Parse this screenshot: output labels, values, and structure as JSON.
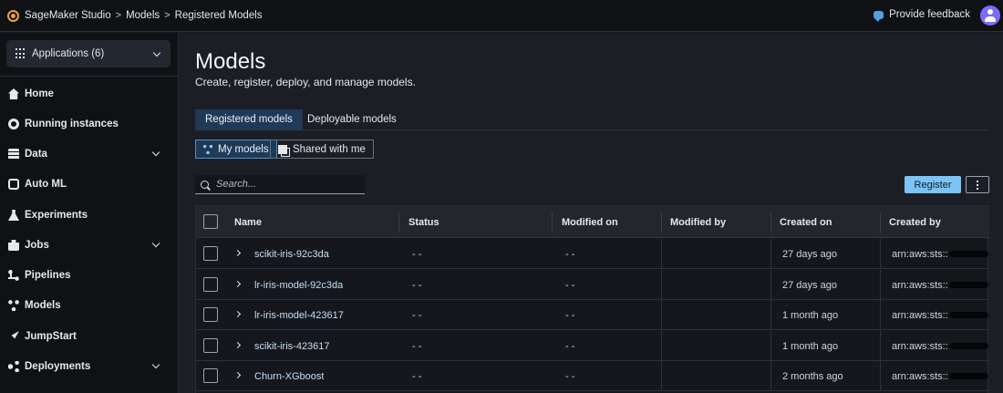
{
  "topbar": {
    "breadcrumbs": [
      "SageMaker Studio",
      "Models",
      "Registered Models"
    ],
    "breadcrumb_separator": ">",
    "feedback_label": "Provide feedback"
  },
  "sidebar": {
    "applications_label": "Applications (6)",
    "items": [
      {
        "label": "Home",
        "icon": "home-icon"
      },
      {
        "label": "Running instances",
        "icon": "gear-icon"
      },
      {
        "label": "Data",
        "icon": "database-icon"
      },
      {
        "label": "Auto ML",
        "icon": "automl-icon"
      },
      {
        "label": "Experiments",
        "icon": "flask-icon"
      },
      {
        "label": "Jobs",
        "icon": "briefcase-icon"
      },
      {
        "label": "Pipelines",
        "icon": "pipeline-icon"
      },
      {
        "label": "Models",
        "icon": "models-icon"
      },
      {
        "label": "JumpStart",
        "icon": "rocket-icon"
      },
      {
        "label": "Deployments",
        "icon": "share-icon"
      }
    ]
  },
  "main": {
    "title": "Models",
    "subtitle": "Create, register, deploy, and manage models.",
    "tabs": [
      "Registered models",
      "Deployable models"
    ],
    "filters": [
      "My models",
      "Shared with me"
    ],
    "search_placeholder": "Search...",
    "register_label": "Register"
  },
  "table": {
    "columns": [
      "Name",
      "Status",
      "Modified on",
      "Modified by",
      "Created on",
      "Created by"
    ],
    "rows": [
      {
        "name": "scikit-iris-92c3da",
        "status": "- -",
        "modified_on": "- -",
        "modified_by": "",
        "created_on": "27 days ago",
        "created_by": "arn:aws:sts::"
      },
      {
        "name": "lr-iris-model-92c3da",
        "status": "- -",
        "modified_on": "- -",
        "modified_by": "",
        "created_on": "27 days ago",
        "created_by": "arn:aws:sts::"
      },
      {
        "name": "lr-iris-model-423617",
        "status": "- -",
        "modified_on": "- -",
        "modified_by": "",
        "created_on": "1 month ago",
        "created_by": "arn:aws:sts::"
      },
      {
        "name": "scikit-iris-423617",
        "status": "- -",
        "modified_on": "- -",
        "modified_by": "",
        "created_on": "1 month ago",
        "created_by": "arn:aws:sts::"
      },
      {
        "name": "Churn-XGboost",
        "status": "- -",
        "modified_on": "- -",
        "modified_by": "",
        "created_on": "2 months ago",
        "created_by": "arn:aws:sts::"
      }
    ]
  },
  "colors": {
    "accent": "#7cc4f5",
    "active_tab": "#1f3a56",
    "background": "#1b1e24"
  }
}
